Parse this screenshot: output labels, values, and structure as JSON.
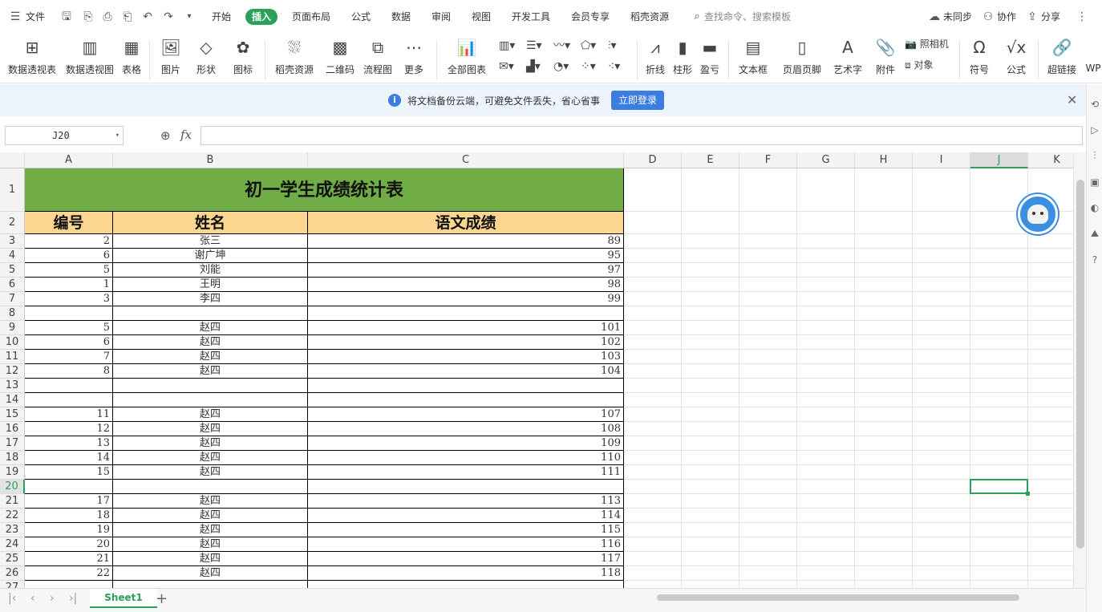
{
  "menu": {
    "file": "文件",
    "tabs": [
      "开始",
      "插入",
      "页面布局",
      "公式",
      "数据",
      "审阅",
      "视图",
      "开发工具",
      "会员专享",
      "稻壳资源"
    ],
    "active_tab": "插入",
    "search_placeholder": "查找命令、搜索模板",
    "sync": "未同步",
    "collab": "协作",
    "share": "分享"
  },
  "ribbon": {
    "pivot_table": "数据透视表",
    "pivot_chart": "数据透视图",
    "table": "表格",
    "picture": "图片",
    "shape": "形状",
    "icon": "图标",
    "docer": "稻壳资源",
    "qrcode": "二维码",
    "flowchart": "流程图",
    "more": "更多",
    "all_charts": "全部图表",
    "sparkline_line": "折线",
    "sparkline_col": "柱形",
    "sparkline_wl": "盈亏",
    "textbox": "文本框",
    "header_footer": "页眉页脚",
    "wordart": "艺术字",
    "attachment": "附件",
    "camera": "照相机",
    "object": "对象",
    "symbol": "符号",
    "formula": "公式",
    "hyperlink": "超链接",
    "wps": "WP"
  },
  "notice": {
    "message": "将文档备份云端，可避免文件丢失，省心省事",
    "button": "立即登录"
  },
  "formula_bar": {
    "cell_ref": "J20",
    "fx": "fx",
    "value": ""
  },
  "columns": [
    "A",
    "B",
    "C",
    "D",
    "E",
    "F",
    "G",
    "H",
    "I",
    "J",
    "K"
  ],
  "selected_column": "J",
  "selected_row": "20",
  "sheet": {
    "title": "初一学生成绩统计表",
    "headers": [
      "编号",
      "姓名",
      "语文成绩"
    ],
    "rows": [
      {
        "r": "3",
        "id": "2",
        "name": "张三",
        "score": "89"
      },
      {
        "r": "4",
        "id": "6",
        "name": "谢广坤",
        "score": "95"
      },
      {
        "r": "5",
        "id": "5",
        "name": "刘能",
        "score": "97"
      },
      {
        "r": "6",
        "id": "1",
        "name": "王明",
        "score": "98"
      },
      {
        "r": "7",
        "id": "3",
        "name": "李四",
        "score": "99"
      },
      {
        "r": "8",
        "id": "",
        "name": "",
        "score": ""
      },
      {
        "r": "9",
        "id": "5",
        "name": "赵四",
        "score": "101"
      },
      {
        "r": "10",
        "id": "6",
        "name": "赵四",
        "score": "102"
      },
      {
        "r": "11",
        "id": "7",
        "name": "赵四",
        "score": "103"
      },
      {
        "r": "12",
        "id": "8",
        "name": "赵四",
        "score": "104"
      },
      {
        "r": "13",
        "id": "",
        "name": "",
        "score": ""
      },
      {
        "r": "14",
        "id": "",
        "name": "",
        "score": ""
      },
      {
        "r": "15",
        "id": "11",
        "name": "赵四",
        "score": "107"
      },
      {
        "r": "16",
        "id": "12",
        "name": "赵四",
        "score": "108"
      },
      {
        "r": "17",
        "id": "13",
        "name": "赵四",
        "score": "109"
      },
      {
        "r": "18",
        "id": "14",
        "name": "赵四",
        "score": "110"
      },
      {
        "r": "19",
        "id": "15",
        "name": "赵四",
        "score": "111"
      },
      {
        "r": "20",
        "id": "",
        "name": "",
        "score": ""
      },
      {
        "r": "21",
        "id": "17",
        "name": "赵四",
        "score": "113"
      },
      {
        "r": "22",
        "id": "18",
        "name": "赵四",
        "score": "114"
      },
      {
        "r": "23",
        "id": "19",
        "name": "赵四",
        "score": "115"
      },
      {
        "r": "24",
        "id": "20",
        "name": "赵四",
        "score": "116"
      },
      {
        "r": "25",
        "id": "21",
        "name": "赵四",
        "score": "117"
      },
      {
        "r": "26",
        "id": "22",
        "name": "赵四",
        "score": "118"
      },
      {
        "r": "27",
        "id": "",
        "name": "",
        "score": ""
      }
    ]
  },
  "sheet_tabs": [
    "Sheet1"
  ],
  "colors": {
    "accent": "#2aa05a",
    "title_fill": "#70ad47",
    "header_fill": "#fbd690",
    "notice_bg": "#eef4fb",
    "login_button": "#3b7de0"
  }
}
